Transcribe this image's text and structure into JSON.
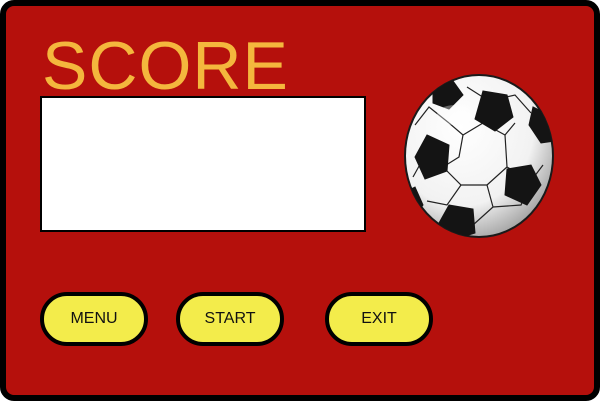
{
  "title": "SCORE",
  "score": {
    "value": ""
  },
  "buttons": {
    "menu": "MENU",
    "start": "START",
    "exit": "EXIT"
  },
  "icons": {
    "ball": "soccer-ball-icon"
  },
  "colors": {
    "background": "#b5100c",
    "title": "#f4b73d",
    "button": "#f3ec4b",
    "border": "#000000"
  }
}
